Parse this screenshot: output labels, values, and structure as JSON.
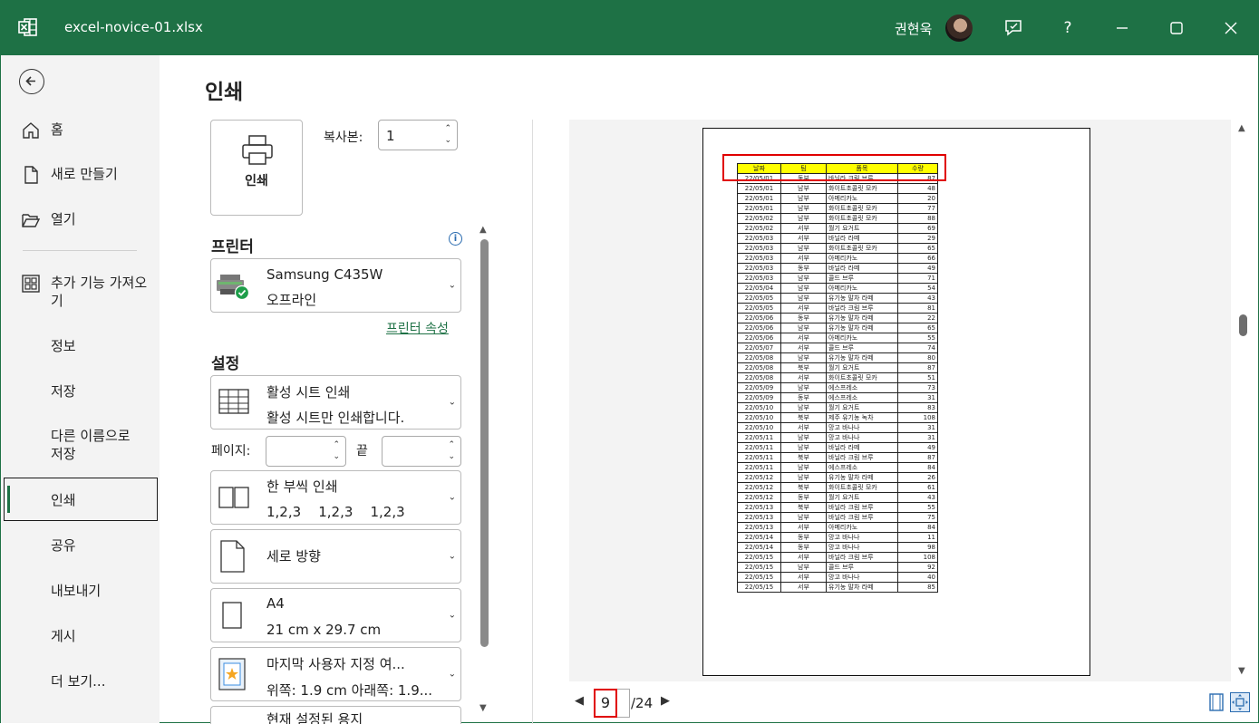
{
  "window": {
    "file_name": "excel-novice-01.xlsx",
    "user_name": "권현욱"
  },
  "nav": {
    "items": [
      {
        "label": "홈",
        "icon": "home-icon"
      },
      {
        "label": "새로 만들기",
        "icon": "new-file-icon"
      },
      {
        "label": "열기",
        "icon": "folder-open-icon"
      },
      {
        "label": "추가 기능 가져오기",
        "icon": "addins-icon"
      },
      {
        "label": "정보"
      },
      {
        "label": "저장"
      },
      {
        "label": "다른 이름으로 저장"
      },
      {
        "label": "인쇄",
        "active": true
      },
      {
        "label": "공유"
      },
      {
        "label": "내보내기"
      },
      {
        "label": "게시"
      },
      {
        "label": "더 보기..."
      }
    ]
  },
  "print": {
    "title": "인쇄",
    "button_label": "인쇄",
    "copies_label": "복사본:",
    "copies_value": "1",
    "printer_section": "프린터",
    "printer_name": "Samsung C435W",
    "printer_status": "오프라인",
    "printer_props_link": "프린터 속성",
    "settings_section": "설정",
    "what_line1": "활성 시트 인쇄",
    "what_line2": "활성 시트만 인쇄합니다.",
    "pages_label": "페이지:",
    "to_label": "끝",
    "collate_line1": "한 부씩 인쇄",
    "collate_line2": "1,2,3    1,2,3    1,2,3",
    "orientation": "세로 방향",
    "paper_line1": "A4",
    "paper_line2": "21 cm x 29.7 cm",
    "margins_line1": "마지막 사용자 지정 여...",
    "margins_line2": "위쪽: 1.9 cm 아래쪽: 1.9...",
    "scaling_partial": "현재 설정된 용지"
  },
  "preview": {
    "headers": [
      "날짜",
      "팀",
      "품목",
      "수량"
    ],
    "rows": [
      [
        "22/05/01",
        "동부",
        "바닐라 크림 브루",
        "87"
      ],
      [
        "22/05/01",
        "남부",
        "화이트초콜릿 모카",
        "48"
      ],
      [
        "22/05/01",
        "남부",
        "아메리카노",
        "20"
      ],
      [
        "22/05/01",
        "남부",
        "화이트초콜릿 모카",
        "77"
      ],
      [
        "22/05/02",
        "남부",
        "화이트초콜릿 모카",
        "88"
      ],
      [
        "22/05/02",
        "서부",
        "월기 요거트",
        "69"
      ],
      [
        "22/05/03",
        "서부",
        "바닐라 라떼",
        "29"
      ],
      [
        "22/05/03",
        "남부",
        "화이트초콜릿 모카",
        "65"
      ],
      [
        "22/05/03",
        "서부",
        "아메리카노",
        "66"
      ],
      [
        "22/05/03",
        "동부",
        "바닐라 라떼",
        "49"
      ],
      [
        "22/05/03",
        "남부",
        "콜드 브루",
        "71"
      ],
      [
        "22/05/04",
        "남부",
        "아메리카노",
        "54"
      ],
      [
        "22/05/05",
        "남부",
        "유기농 말차 라떼",
        "43"
      ],
      [
        "22/05/05",
        "서부",
        "바닐라 크림 브루",
        "81"
      ],
      [
        "22/05/06",
        "동부",
        "유기농 말차 라떼",
        "22"
      ],
      [
        "22/05/06",
        "남부",
        "유기농 말차 라떼",
        "65"
      ],
      [
        "22/05/06",
        "서부",
        "아메리카노",
        "55"
      ],
      [
        "22/05/07",
        "서부",
        "콜드 브루",
        "74"
      ],
      [
        "22/05/08",
        "남부",
        "유기농 말차 라떼",
        "80"
      ],
      [
        "22/05/08",
        "북부",
        "월기 요거트",
        "87"
      ],
      [
        "22/05/08",
        "서부",
        "화이트초콜릿 모카",
        "51"
      ],
      [
        "22/05/09",
        "남부",
        "에스프레소",
        "73"
      ],
      [
        "22/05/09",
        "동부",
        "에스프레소",
        "31"
      ],
      [
        "22/05/10",
        "남부",
        "월기 요거트",
        "83"
      ],
      [
        "22/05/10",
        "북부",
        "제주 유기농 녹차",
        "108"
      ],
      [
        "22/05/10",
        "서부",
        "망고 바나나",
        "31"
      ],
      [
        "22/05/11",
        "남부",
        "망고 바나나",
        "31"
      ],
      [
        "22/05/11",
        "남부",
        "바닐라 라떼",
        "49"
      ],
      [
        "22/05/11",
        "북부",
        "바닐라 크림 브루",
        "87"
      ],
      [
        "22/05/11",
        "남부",
        "에스프레소",
        "84"
      ],
      [
        "22/05/12",
        "남부",
        "유기농 말차 라떼",
        "26"
      ],
      [
        "22/05/12",
        "북부",
        "화이트초콜릿 모카",
        "61"
      ],
      [
        "22/05/12",
        "동부",
        "월기 요거트",
        "43"
      ],
      [
        "22/05/13",
        "북부",
        "바닐라 크림 브루",
        "55"
      ],
      [
        "22/05/13",
        "남부",
        "바닐라 크림 브루",
        "75"
      ],
      [
        "22/05/13",
        "서부",
        "아메리카노",
        "84"
      ],
      [
        "22/05/14",
        "동부",
        "망고 바나나",
        "11"
      ],
      [
        "22/05/14",
        "동부",
        "망고 바나나",
        "98"
      ],
      [
        "22/05/15",
        "서부",
        "바닐라 크림 브루",
        "108"
      ],
      [
        "22/05/15",
        "남부",
        "콜드 브루",
        "92"
      ],
      [
        "22/05/15",
        "서부",
        "망고 바나나",
        "40"
      ],
      [
        "22/05/15",
        "서부",
        "유기농 말차 라떼",
        "85"
      ]
    ],
    "current_page": "9",
    "total_pages": "/24"
  },
  "colors": {
    "title_bar": "#1e7145",
    "highlight": "#e00000",
    "header_fill": "#ffff00"
  }
}
